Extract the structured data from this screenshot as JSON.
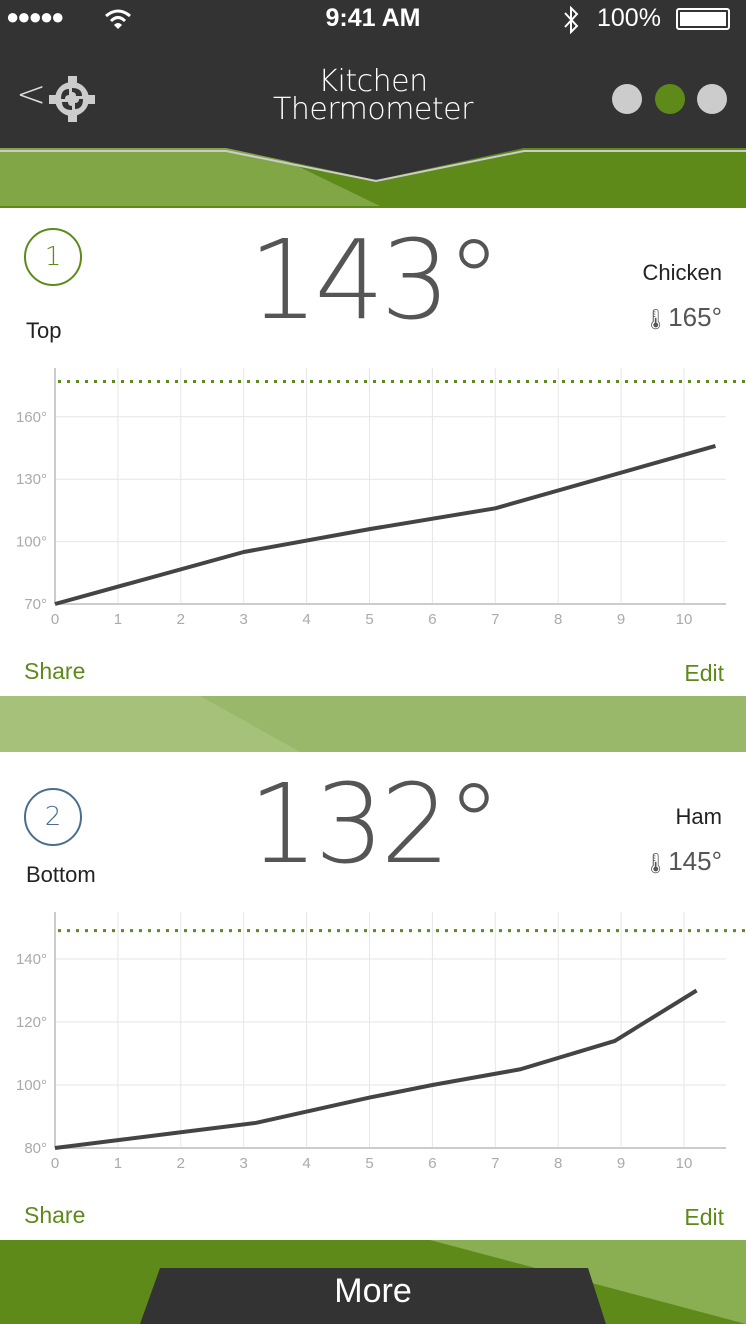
{
  "status_bar": {
    "signal": "●●●●●",
    "time": "9:41 AM",
    "battery": "100%",
    "icons": [
      "signal-dots",
      "wifi-icon",
      "bluetooth-icon",
      "battery-icon"
    ]
  },
  "header": {
    "back": "<",
    "title_line1": "Kitchen",
    "title_line2": "Thermometer",
    "icons": [
      "back-chevron-icon",
      "gear-logo-icon"
    ],
    "page_dots": 3,
    "active_dot": 2
  },
  "colors": {
    "header_bg": "#333333",
    "accent_green": "#5e8a1a",
    "light_green": "#9ab86a",
    "probe2_blue": "#4a6e8c",
    "line": "#444444"
  },
  "probes": [
    {
      "number": "1",
      "label": "Top",
      "temp": "143°",
      "food": "Chicken",
      "target": "165°",
      "share": "Share",
      "edit": "Edit",
      "ring_color": "#5e8a1a"
    },
    {
      "number": "2",
      "label": "Bottom",
      "temp": "132°",
      "food": "Ham",
      "target": "145°",
      "share": "Share",
      "edit": "Edit",
      "ring_color": "#4a6e8c"
    }
  ],
  "footer": {
    "more": "More"
  },
  "chart_data": [
    {
      "type": "line",
      "x_ticks": [
        "0",
        "1",
        "2",
        "3",
        "4",
        "5",
        "6",
        "7",
        "8",
        "9",
        "10"
      ],
      "y_ticks": [
        "70°",
        "100°",
        "130°",
        "160°"
      ],
      "y_tick_values": [
        70,
        100,
        130,
        160
      ],
      "xlim": [
        0,
        10.7
      ],
      "ylim": [
        70,
        183
      ],
      "grid": true,
      "target_line": 177,
      "x": [
        0,
        3,
        5,
        7,
        10.5
      ],
      "y": [
        70,
        95,
        106,
        116,
        146
      ]
    },
    {
      "type": "line",
      "x_ticks": [
        "0",
        "1",
        "2",
        "3",
        "4",
        "5",
        "6",
        "7",
        "8",
        "9",
        "10"
      ],
      "y_ticks": [
        "80°",
        "100°",
        "120°",
        "140°"
      ],
      "y_tick_values": [
        80,
        100,
        120,
        140
      ],
      "xlim": [
        0,
        10.7
      ],
      "ylim": [
        80,
        155
      ],
      "grid": true,
      "target_line": 149,
      "x": [
        0,
        1,
        2,
        3.2,
        5,
        6,
        7.4,
        8.9,
        10.2
      ],
      "y": [
        80,
        82.5,
        85,
        88,
        96,
        100,
        105,
        114,
        130
      ]
    }
  ]
}
